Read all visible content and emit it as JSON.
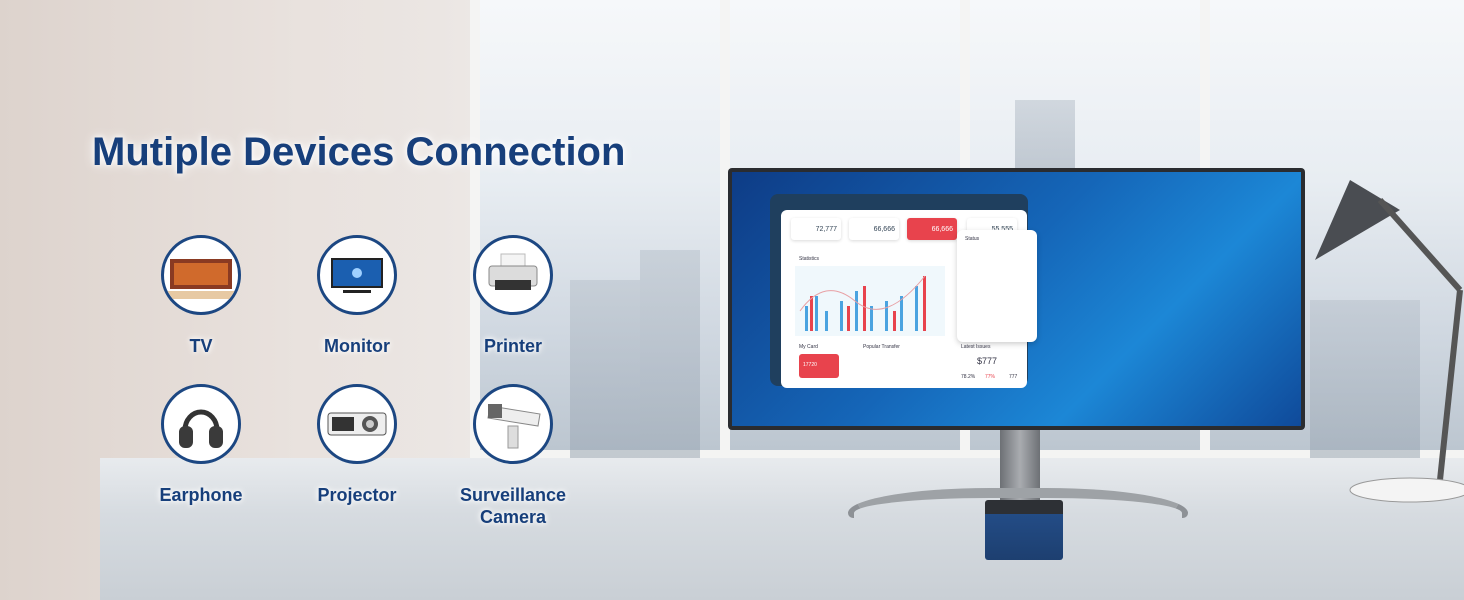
{
  "headline": "Mutiple Devices Connection",
  "devices": [
    {
      "label": "TV",
      "icon": "tv-icon"
    },
    {
      "label": "Monitor",
      "icon": "monitor-icon"
    },
    {
      "label": "Printer",
      "icon": "printer-icon"
    },
    {
      "label": "Earphone",
      "icon": "headphones-icon"
    },
    {
      "label": "Projector",
      "icon": "projector-icon"
    },
    {
      "label": "Surveillance",
      "label2": "Camera",
      "icon": "security-camera-icon"
    }
  ],
  "screen_dashboard": {
    "stats": [
      "72,777",
      "66,666",
      "66,666",
      "55,555"
    ],
    "statistics_title": "Statistics",
    "status_title": "Status",
    "card_title": "My Card",
    "card_number": "17720",
    "transfer_title": "Popular Transfer",
    "latest_title": "Latest Issues",
    "amount": "$777",
    "percent1": "78.2%",
    "percent2": "77%",
    "count": "777"
  },
  "colors": {
    "title": "#173f7b",
    "accent": "#e8434d",
    "screen": "#1566b8"
  }
}
